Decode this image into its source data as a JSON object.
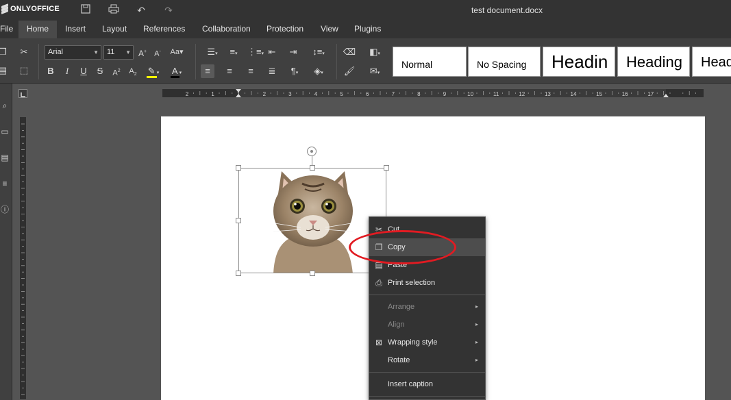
{
  "app": {
    "brand": "ONLYOFFICE",
    "document_title": "test document.docx"
  },
  "menu": {
    "tabs": [
      "File",
      "Home",
      "Insert",
      "Layout",
      "References",
      "Collaboration",
      "Protection",
      "View",
      "Plugins"
    ],
    "active": "Home"
  },
  "toolbar": {
    "font_name": "Arial",
    "font_size": "11",
    "styles": [
      "Normal",
      "No Spacing",
      "Headin",
      "Heading",
      "Head"
    ]
  },
  "ruler": {
    "h_numbers": [
      "2",
      "1",
      "1",
      "2",
      "3",
      "4",
      "5",
      "6",
      "7",
      "8",
      "9",
      "10",
      "11",
      "12",
      "13",
      "14",
      "15",
      "16",
      "17"
    ]
  },
  "context_menu": {
    "items": [
      {
        "label": "Cut",
        "icon": "scissors-icon",
        "enabled": true
      },
      {
        "label": "Copy",
        "icon": "copy-icon",
        "enabled": true,
        "highlighted": true
      },
      {
        "label": "Paste",
        "icon": "paste-icon",
        "enabled": true
      },
      {
        "label": "Print selection",
        "icon": "print-icon",
        "enabled": true
      },
      {
        "label": "Arrange",
        "enabled": false,
        "submenu": true
      },
      {
        "label": "Align",
        "enabled": false,
        "submenu": true
      },
      {
        "label": "Wrapping style",
        "icon": "wrapping-icon",
        "enabled": true,
        "submenu": true
      },
      {
        "label": "Rotate",
        "enabled": true,
        "submenu": true
      },
      {
        "label": "Insert caption",
        "enabled": true
      }
    ]
  },
  "colors": {
    "accent": "#e11b22",
    "dark_bg": "#333333",
    "toolbar_bg": "#404040"
  }
}
